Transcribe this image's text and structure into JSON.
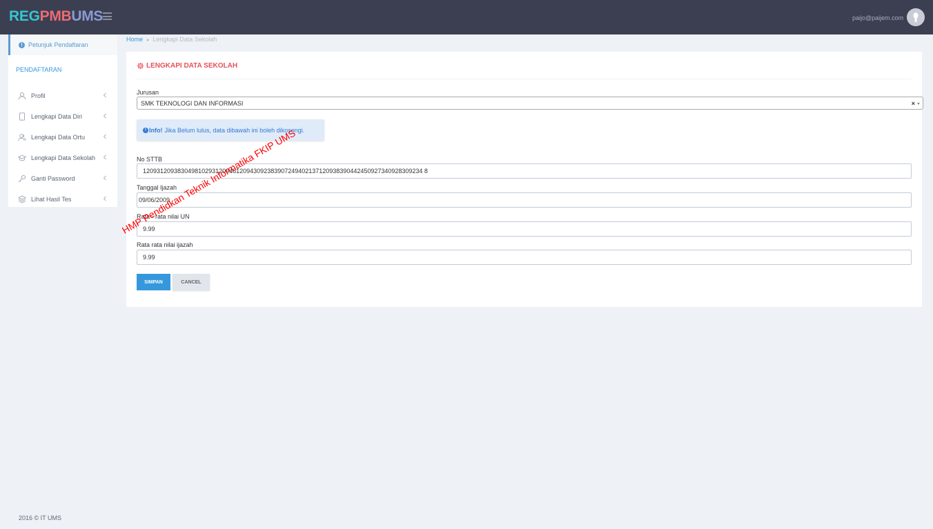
{
  "header": {
    "logo": {
      "part1": "REG",
      "part2": "PMB",
      "part3": "UMS"
    },
    "user_email": "paijo@paijem.com"
  },
  "sidebar": {
    "top_item": "Petunjuk Pendaftaran",
    "heading": "PENDAFTARAN",
    "items": [
      {
        "label": "Profil",
        "icon": "user-icon"
      },
      {
        "label": "Lengkapi Data Diri",
        "icon": "tablet-icon"
      },
      {
        "label": "Lengkapi Data Ortu",
        "icon": "users-icon"
      },
      {
        "label": "Lengkapi Data Sekolah",
        "icon": "graduation-cap-icon"
      },
      {
        "label": "Ganti Password",
        "icon": "key-icon"
      },
      {
        "label": "Lihat Hasil Tes",
        "icon": "layers-icon"
      }
    ]
  },
  "breadcrumb": {
    "home": "Home",
    "current": "Lengkapi Data Sekolah"
  },
  "form": {
    "title": "LENGKAPI DATA SEKOLAH",
    "jurusan_label": "Jurusan",
    "jurusan_value": "SMK TEKNOLOGI DAN INFORMASI",
    "alert_strong": "Info!",
    "alert_text": "Jika Belum lulus, data dibawah ini boleh dikosongi.",
    "no_sttb_label": "No STTB",
    "no_sttb_value": "120931209383049810293120948120943092383907249402137120938390442450927340928309234 8",
    "tanggal_label": "Tanggal Ijazah",
    "tanggal_value": "09/06/2009",
    "un_label": "Rata - rata nilai UN",
    "un_value": "9.99",
    "ijazah_label": "Rata rata nilai ijazah",
    "ijazah_value": "9.99",
    "save_label": "SIMPAN",
    "cancel_label": "CANCEL"
  },
  "watermark": "HMP Pendidkan Teknik Informatika FKIP UMS",
  "footer": "2016 © IT UMS",
  "colors": {
    "topbar": "#3b3f51",
    "accent": "#3598dc",
    "title": "#e7505a"
  }
}
